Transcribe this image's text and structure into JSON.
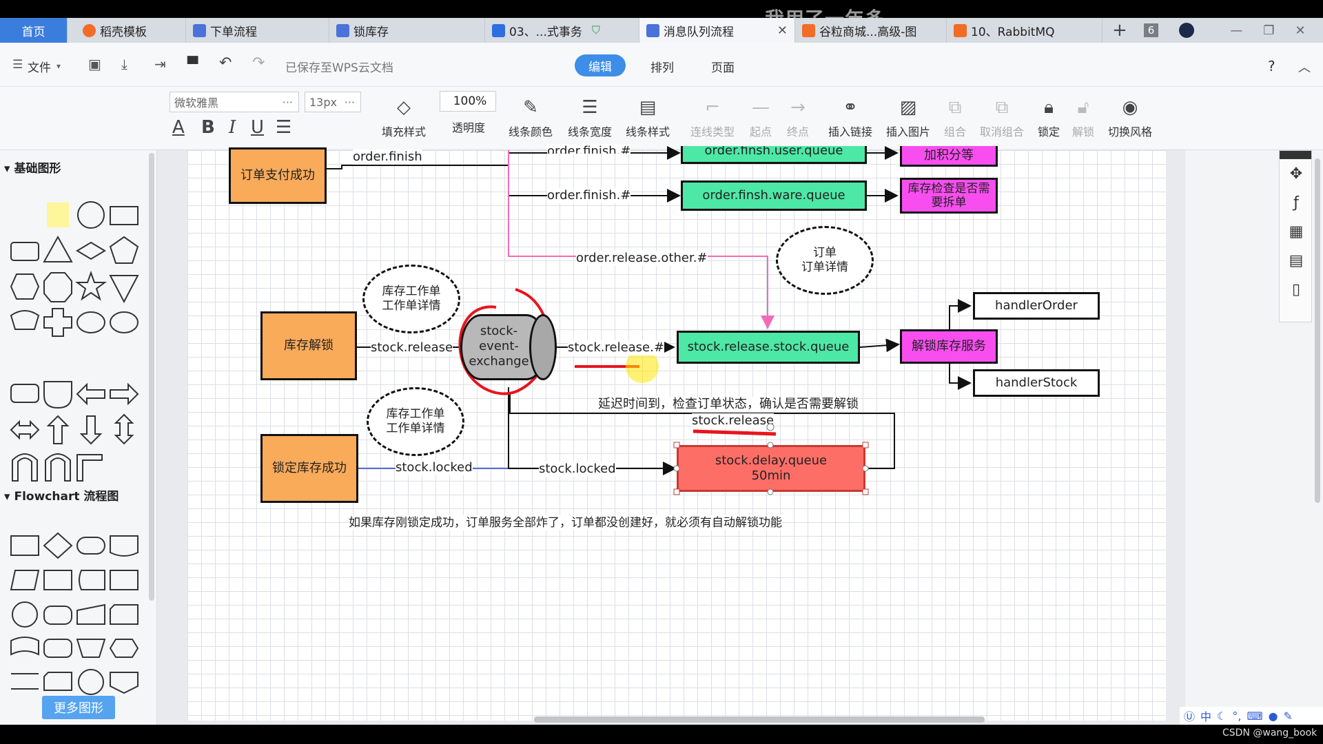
{
  "tabs": {
    "home": "首页",
    "t1": "稻壳模板",
    "t2": "下单流程",
    "t3": "锁库存",
    "t4": "03、...式事务",
    "t5": "消息队列流程",
    "t6": "谷粒商城...高级-图",
    "t7": "10、RabbitMQ",
    "count": "6",
    "watermark": "我用了一年多"
  },
  "menu": {
    "file": "文件",
    "saved": "已保存至WPS云文档",
    "edit": "编辑",
    "arrange": "排列",
    "page": "页面",
    "help": "?"
  },
  "toolbar": {
    "font": "微软雅黑",
    "size": "13px",
    "opacity_value": "100%",
    "fill": "填充样式",
    "opacity": "透明度",
    "line_color": "线条颜色",
    "line_width": "线条宽度",
    "line_style": "线条样式",
    "connector": "连线类型",
    "start": "起点",
    "end": "终点",
    "insert_link": "插入链接",
    "insert_image": "插入图片",
    "group": "组合",
    "ungroup": "取消组合",
    "lock": "锁定",
    "unlock": "解锁",
    "style": "切换风格"
  },
  "sidebar": {
    "basic": "基础图形",
    "flowchart": "Flowchart 流程图",
    "more": "更多图形"
  },
  "diagram": {
    "order_paid": "订单支付成功",
    "order_finish": "order.finish",
    "order_finish_hash_top": "order.finish.#",
    "user_queue": "order.finsh.user.queue",
    "points": "加积分等",
    "order_finish_hash": "order.finish.#",
    "ware_queue": "order.finsh.ware.queue",
    "stock_check": "库存检查是否需要拆单",
    "release_other": "order.release.other.#",
    "order_note": "订单\n订单详情",
    "stock_note1": "库存工作单\n工作单详情",
    "stock_unlock": "库存解锁",
    "stock_release_edge": "stock.release",
    "exchange": "stock-\nevent-\nexchange",
    "stock_release_hash": "stock.release.#",
    "release_queue": "stock.release.stock.queue",
    "unlock_service": "解锁库存服务",
    "handler_order": "handlerOrder",
    "handler_stock": "handlerStock",
    "delay_note": "延迟时间到，检查订单状态，确认是否需要解锁",
    "delay_key": "stock.release",
    "stock_note2": "库存工作单\n工作单详情",
    "lock_ok": "锁定库存成功",
    "locked1": "stock.locked",
    "locked2": "stock.locked",
    "delay_queue": "stock.delay.queue\n50min",
    "footer_note": "如果库存刚锁定成功，订单服务全部炸了，订单都没创建好，就必须有自动解锁功能"
  },
  "status": {
    "credit": "CSDN @wang_book"
  },
  "colors": {
    "orange": "#f9ab5a",
    "green": "#4de8a6",
    "magenta": "#f84ef0",
    "red": "#fd6e67",
    "pink_line": "#f16bb7",
    "blue_line": "#5b6bd6",
    "accent": "#3c8ee8"
  }
}
